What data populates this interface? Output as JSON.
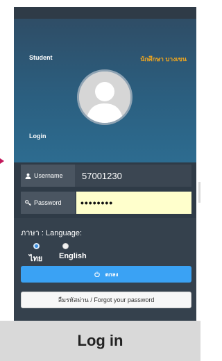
{
  "hero": {
    "student_label": "Student",
    "school_label": "นักศึกษา บางเขน",
    "login_label": "Login",
    "avatar_icon": "user-silhouette-icon"
  },
  "form": {
    "username_label": "Username",
    "username_value": "57001230",
    "username_icon": "user-icon",
    "password_label": "Password",
    "password_value": "••••••••",
    "password_icon": "key-icon"
  },
  "language": {
    "title": "ภาษา : Language:",
    "options": [
      {
        "label": "ไทย",
        "selected": true
      },
      {
        "label": "English",
        "selected": false
      }
    ]
  },
  "buttons": {
    "ok_label": "ตกลง",
    "ok_icon": "power-icon",
    "forgot_label": "ลืมรหัสผ่าน / Forgot your password"
  },
  "caption": "Log in",
  "colors": {
    "accent_blue": "#3aa2f4",
    "school_orange": "#f5a81c",
    "password_bg": "#ffffcc",
    "panel_dark": "#2f3b47"
  }
}
